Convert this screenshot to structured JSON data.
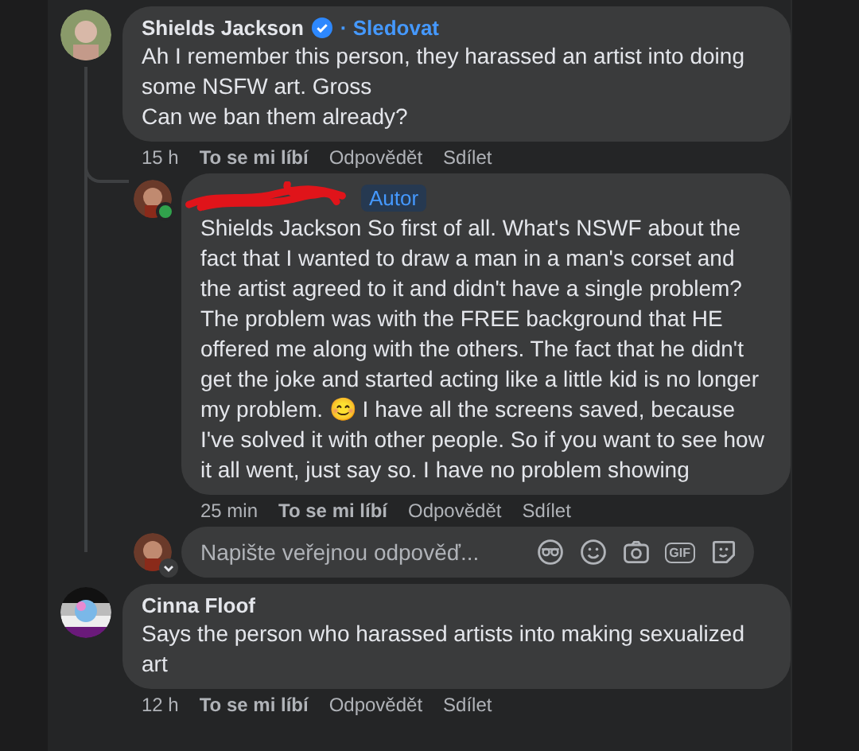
{
  "comments": [
    {
      "author": "Shields Jackson",
      "verified": true,
      "follow": "· Sledovat",
      "online": false,
      "name_redacted": false,
      "text": "Ah I remember this person, they harassed an artist into doing some NSFW art. Gross\nCan we ban them already?",
      "time": "15 h",
      "actions": [
        "To se mi líbí",
        "Odpovědět",
        "Sdílet"
      ],
      "replies": [
        {
          "verified": false,
          "author_badge": "Autor",
          "online": true,
          "name_redacted": true,
          "text": "Shields Jackson So first of all. What's NSWF about the fact that I wanted to draw a man in a man's corset and the artist agreed to it and didn't have a single problem?The problem was with the FREE background that HE offered me along with the others. The fact that he didn't get the joke and started acting like a little kid is no longer my problem. 😊 I have all the screens saved, because I've solved it with other people. So if you want to see how it all went, just say so. I have no problem showing",
          "time": "25 min",
          "actions": [
            "To se mi líbí",
            "Odpovědět",
            "Sdílet"
          ]
        }
      ],
      "reply_box": {
        "placeholder": "Napište veřejnou odpověď...",
        "gif_label": "GIF"
      }
    },
    {
      "author": "Cinna Floof",
      "verified": false,
      "online": false,
      "name_redacted": false,
      "text": "Says the person who harassed artists into making sexualized art",
      "time": "12 h",
      "actions": [
        "To se mi líbí",
        "Odpovědět",
        "Sdílet"
      ]
    }
  ]
}
